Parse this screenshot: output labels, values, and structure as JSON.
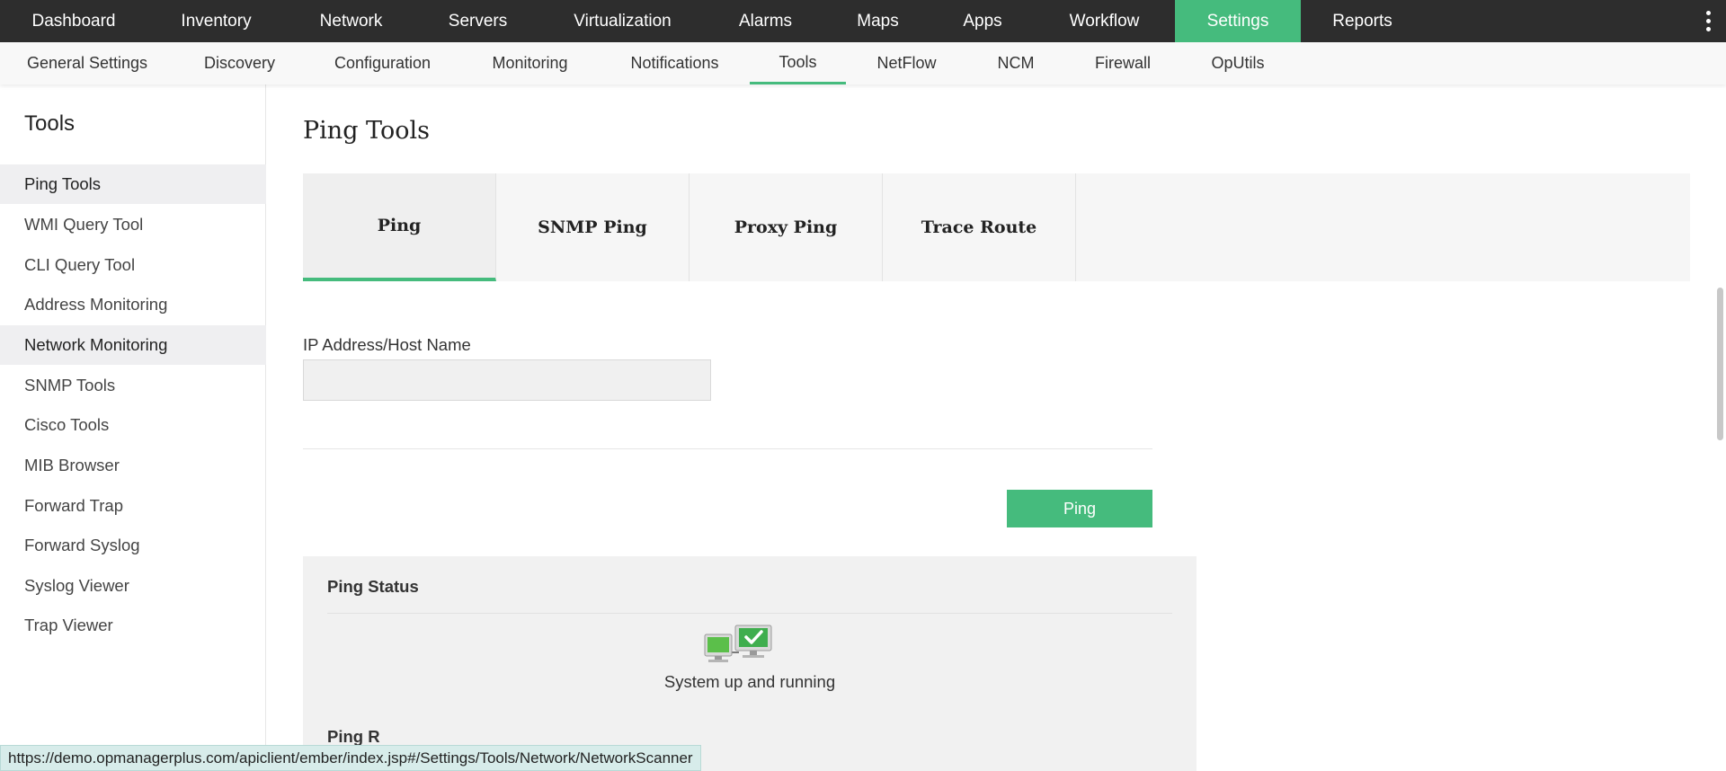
{
  "topnav": {
    "items": [
      {
        "label": "Dashboard"
      },
      {
        "label": "Inventory"
      },
      {
        "label": "Network"
      },
      {
        "label": "Servers"
      },
      {
        "label": "Virtualization"
      },
      {
        "label": "Alarms"
      },
      {
        "label": "Maps"
      },
      {
        "label": "Apps"
      },
      {
        "label": "Workflow"
      },
      {
        "label": "Settings"
      },
      {
        "label": "Reports"
      }
    ],
    "active": "Settings",
    "menu_icon": "kebab-menu-icon"
  },
  "subnav": {
    "items": [
      {
        "label": "General Settings"
      },
      {
        "label": "Discovery"
      },
      {
        "label": "Configuration"
      },
      {
        "label": "Monitoring"
      },
      {
        "label": "Notifications"
      },
      {
        "label": "Tools"
      },
      {
        "label": "NetFlow"
      },
      {
        "label": "NCM"
      },
      {
        "label": "Firewall"
      },
      {
        "label": "OpUtils"
      }
    ],
    "active": "Tools"
  },
  "sidebar": {
    "title": "Tools",
    "items": [
      {
        "label": "Ping Tools"
      },
      {
        "label": "WMI Query Tool"
      },
      {
        "label": "CLI Query Tool"
      },
      {
        "label": "Address Monitoring"
      },
      {
        "label": "Network Monitoring"
      },
      {
        "label": "SNMP Tools"
      },
      {
        "label": "Cisco Tools"
      },
      {
        "label": "MIB Browser"
      },
      {
        "label": "Forward Trap"
      },
      {
        "label": "Forward Syslog"
      },
      {
        "label": "Syslog Viewer"
      },
      {
        "label": "Trap Viewer"
      }
    ]
  },
  "main": {
    "title": "Ping Tools",
    "tabs": [
      {
        "label": "Ping"
      },
      {
        "label": "SNMP Ping"
      },
      {
        "label": "Proxy Ping"
      },
      {
        "label": "Trace Route"
      }
    ],
    "active_tab": "Ping",
    "ip_field": {
      "label": "IP Address/Host Name",
      "value": "",
      "placeholder": ""
    },
    "ping_button": "Ping",
    "status": {
      "title": "Ping Status",
      "icon": "network-monitors-check-icon",
      "message": "System up and running",
      "next_section": "Ping R"
    }
  },
  "status_url": "https://demo.opmanagerplus.com/apiclient/ember/index.jsp#/Settings/Tools/Network/NetworkScanner",
  "colors": {
    "accent": "#45bb7d",
    "topbar": "#2d2d2d",
    "subbar": "#f8f8f8"
  }
}
